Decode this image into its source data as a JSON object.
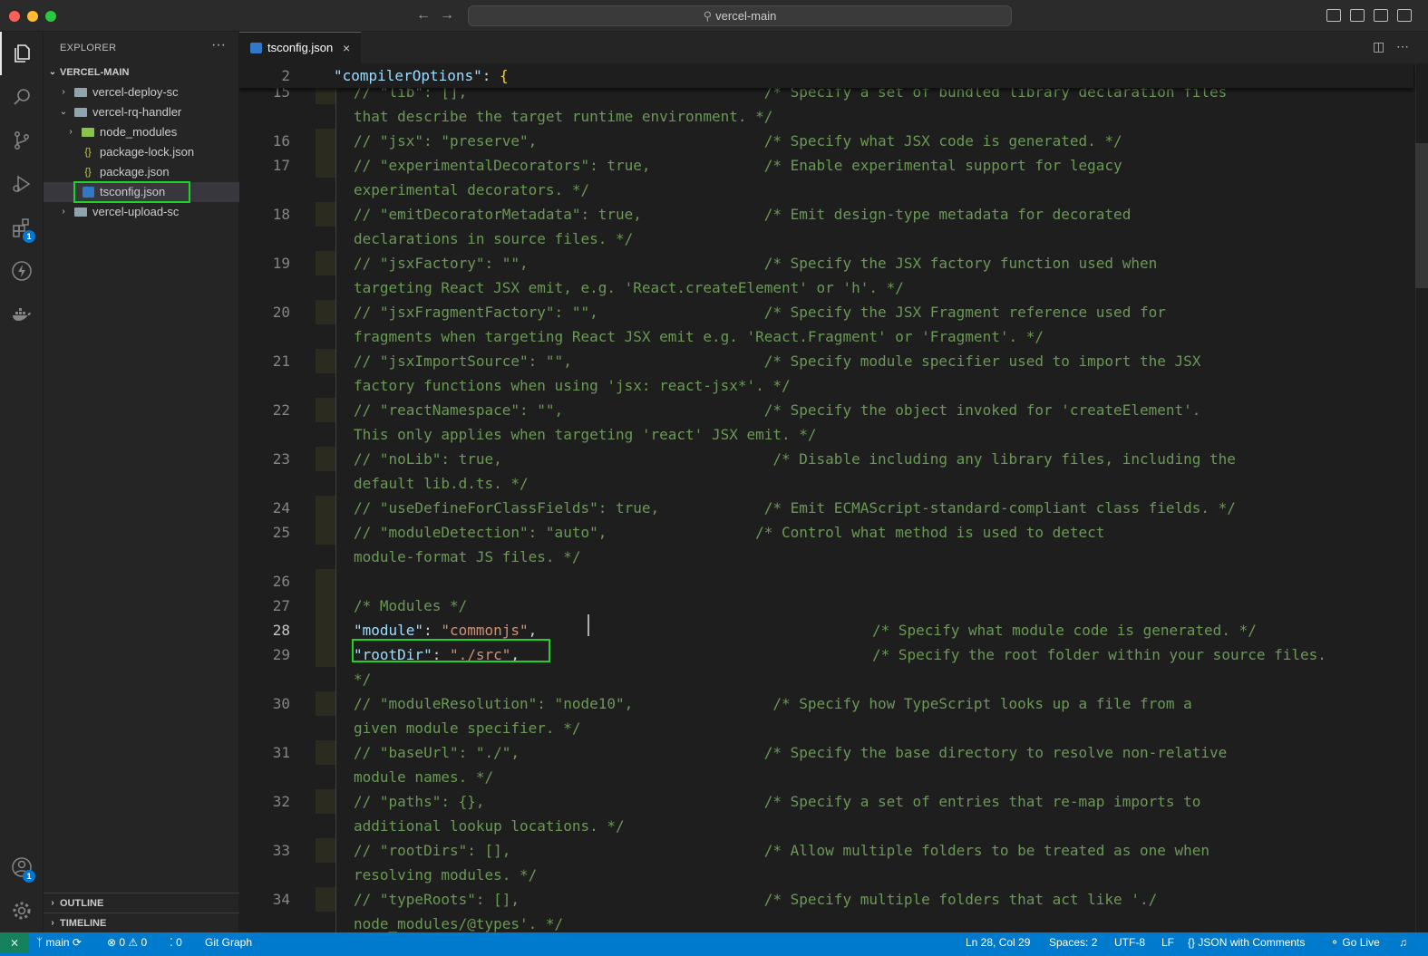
{
  "window": {
    "title": "vercel-main"
  },
  "sidebar": {
    "title": "EXPLORER",
    "more": "···",
    "root": "VERCEL-MAIN",
    "items": [
      {
        "label": "vercel-deploy-sc"
      },
      {
        "label": "vercel-rq-handler"
      },
      {
        "label": "node_modules"
      },
      {
        "label": "package-lock.json"
      },
      {
        "label": "package.json"
      },
      {
        "label": "tsconfig.json"
      },
      {
        "label": "vercel-upload-sc"
      }
    ],
    "outline": "OUTLINE",
    "timeline": "TIMELINE"
  },
  "tabs": [
    {
      "label": "tsconfig.json",
      "close": "×"
    }
  ],
  "editor": {
    "sticky": {
      "num": "2",
      "key": "\"compilerOptions\"",
      "rest": ": ",
      "brace": "{"
    },
    "lines": [
      {
        "num": "15",
        "text": "// \"lib\": [],                                  /* Specify a set of bundled library declaration files"
      },
      {
        "num": "",
        "text": "that describe the target runtime environment. */"
      },
      {
        "num": "16",
        "text": "// \"jsx\": \"preserve\",                          /* Specify what JSX code is generated. */"
      },
      {
        "num": "17",
        "text": "// \"experimentalDecorators\": true,             /* Enable experimental support for legacy"
      },
      {
        "num": "",
        "text": "experimental decorators. */"
      },
      {
        "num": "18",
        "text": "// \"emitDecoratorMetadata\": true,              /* Emit design-type metadata for decorated"
      },
      {
        "num": "",
        "text": "declarations in source files. */"
      },
      {
        "num": "19",
        "text": "// \"jsxFactory\": \"\",                           /* Specify the JSX factory function used when"
      },
      {
        "num": "",
        "text": "targeting React JSX emit, e.g. 'React.createElement' or 'h'. */"
      },
      {
        "num": "20",
        "text": "// \"jsxFragmentFactory\": \"\",                   /* Specify the JSX Fragment reference used for"
      },
      {
        "num": "",
        "text": "fragments when targeting React JSX emit e.g. 'React.Fragment' or 'Fragment'. */"
      },
      {
        "num": "21",
        "text": "// \"jsxImportSource\": \"\",                      /* Specify module specifier used to import the JSX"
      },
      {
        "num": "",
        "text": "factory functions when using 'jsx: react-jsx*'. */"
      },
      {
        "num": "22",
        "text": "// \"reactNamespace\": \"\",                       /* Specify the object invoked for 'createElement'."
      },
      {
        "num": "",
        "text": "This only applies when targeting 'react' JSX emit. */"
      },
      {
        "num": "23",
        "text": "// \"noLib\": true,                               /* Disable including any library files, including the"
      },
      {
        "num": "",
        "text": "default lib.d.ts. */"
      },
      {
        "num": "24",
        "text": "// \"useDefineForClassFields\": true,            /* Emit ECMAScript-standard-compliant class fields. */"
      },
      {
        "num": "25",
        "text": "// \"moduleDetection\": \"auto\",                 /* Control what method is used to detect"
      },
      {
        "num": "",
        "text": "module-format JS files. */"
      },
      {
        "num": "26",
        "text": ""
      },
      {
        "num": "27",
        "text": "/* Modules */"
      },
      {
        "num": "28",
        "key": "\"module\"",
        "sep": ": ",
        "val": "\"commonjs\"",
        "end": ",",
        "comment": "/* Specify what module code is generated. */"
      },
      {
        "num": "29",
        "key": "\"rootDir\"",
        "sep": ": ",
        "val": "\"./src\"",
        "end": ",",
        "comment": "/* Specify the root folder within your source files."
      },
      {
        "num": "",
        "text": "*/"
      },
      {
        "num": "30",
        "text": "// \"moduleResolution\": \"node10\",                /* Specify how TypeScript looks up a file from a"
      },
      {
        "num": "",
        "text": "given module specifier. */"
      },
      {
        "num": "31",
        "text": "// \"baseUrl\": \"./\",                            /* Specify the base directory to resolve non-relative"
      },
      {
        "num": "",
        "text": "module names. */"
      },
      {
        "num": "32",
        "text": "// \"paths\": {},                                /* Specify a set of entries that re-map imports to"
      },
      {
        "num": "",
        "text": "additional lookup locations. */"
      },
      {
        "num": "33",
        "text": "// \"rootDirs\": [],                             /* Allow multiple folders to be treated as one when"
      },
      {
        "num": "",
        "text": "resolving modules. */"
      },
      {
        "num": "34",
        "text": "// \"typeRoots\": [],                            /* Specify multiple folders that act like './"
      },
      {
        "num": "",
        "text": "node_modules/@types'. */"
      }
    ]
  },
  "statusbar": {
    "branch": "main",
    "errors": "0",
    "warnings": "0",
    "ports": "0",
    "git_graph": "Git Graph",
    "position": "Ln 28, Col 29",
    "spaces": "Spaces: 2",
    "encoding": "UTF-8",
    "eol": "LF",
    "language": "JSON with Comments",
    "go_live": "Go Live"
  },
  "badges": {
    "extensions": "1",
    "accounts": "1"
  },
  "colors": {
    "accent": "#007acc",
    "highlight": "#1fd225"
  }
}
